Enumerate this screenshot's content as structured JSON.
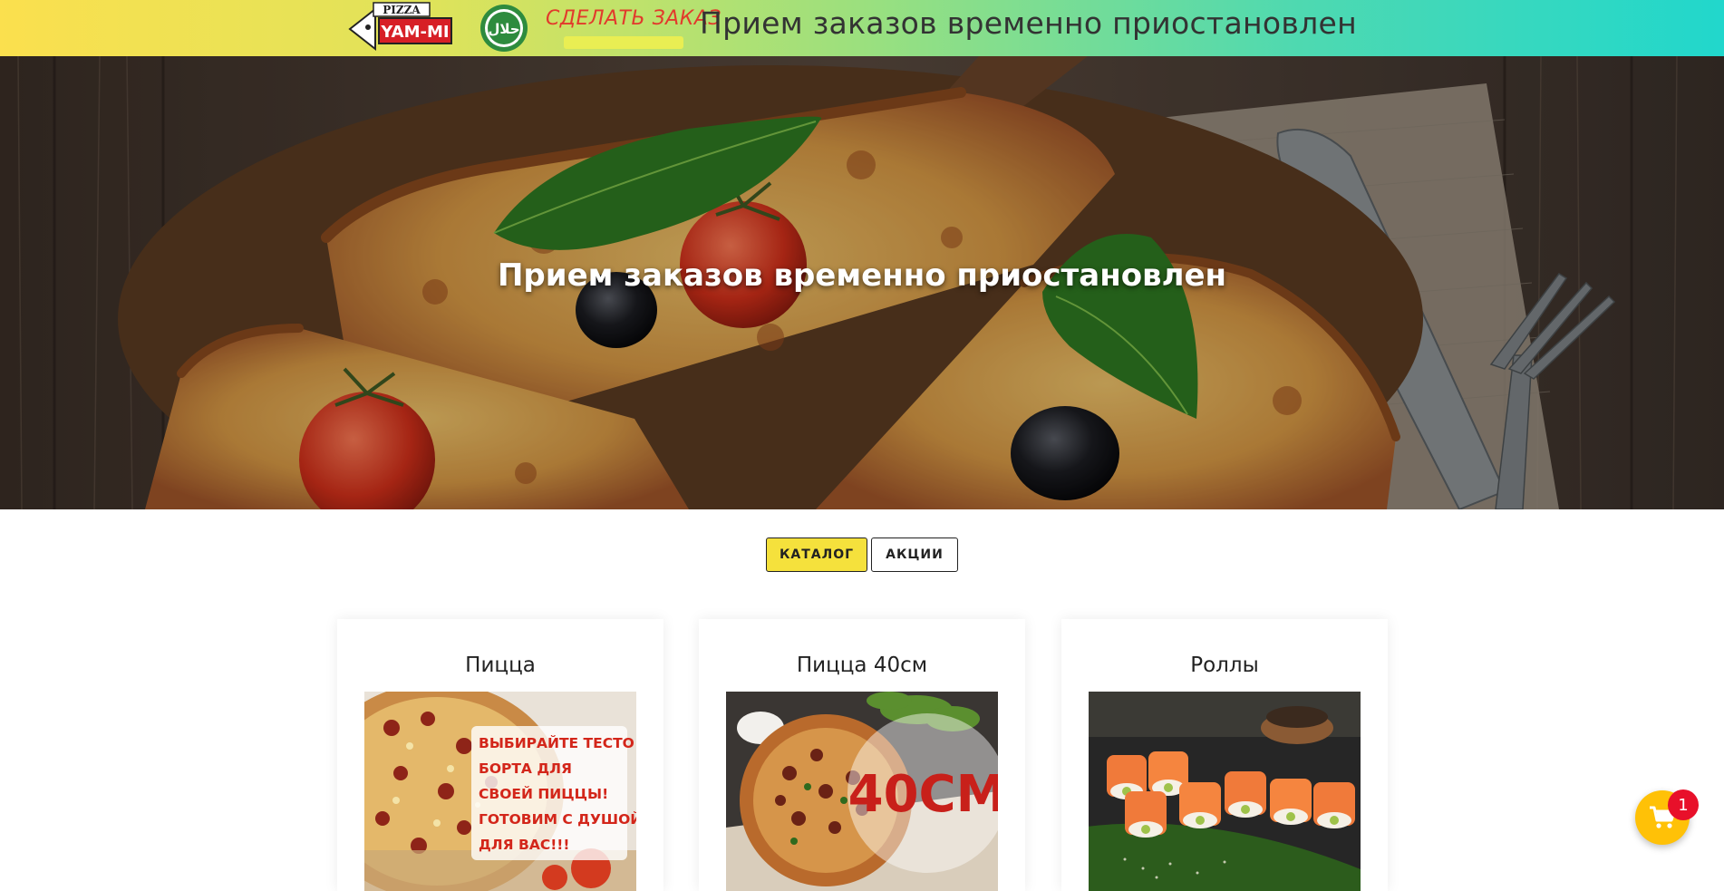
{
  "topbar": {
    "logo": {
      "top_text": "PIZZA",
      "main_text": "YAM-MI"
    },
    "halal_badge": {
      "text": "حلال"
    },
    "order_link": "СДЕЛАТЬ ЗАКАЗ",
    "message": "Прием заказов временно приостановлен"
  },
  "hero": {
    "title": "Прием заказов временно приостановлен"
  },
  "tabs": [
    {
      "label": "КАТАЛОГ",
      "active": true
    },
    {
      "label": "АКЦИИ",
      "active": false
    }
  ],
  "categories": [
    {
      "title": "Пицца",
      "promo_lines": [
        "ВЫБИРАЙТЕ ТЕСТО И",
        "БОРТА ДЛЯ",
        "СВОЕЙ ПИЦЦЫ!",
        "ГОТОВИМ С ДУШОЙ",
        "ДЛЯ ВАС!!!"
      ]
    },
    {
      "title": "Пицца 40см",
      "promo_lines": [
        "40СМ"
      ]
    },
    {
      "title": "Роллы"
    }
  ],
  "cart": {
    "count": "1"
  },
  "colors": {
    "accent_yellow": "#f5e13c",
    "order_red": "#e23a2c",
    "cart_yellow": "#ffc107",
    "badge_red": "#e8102a"
  }
}
